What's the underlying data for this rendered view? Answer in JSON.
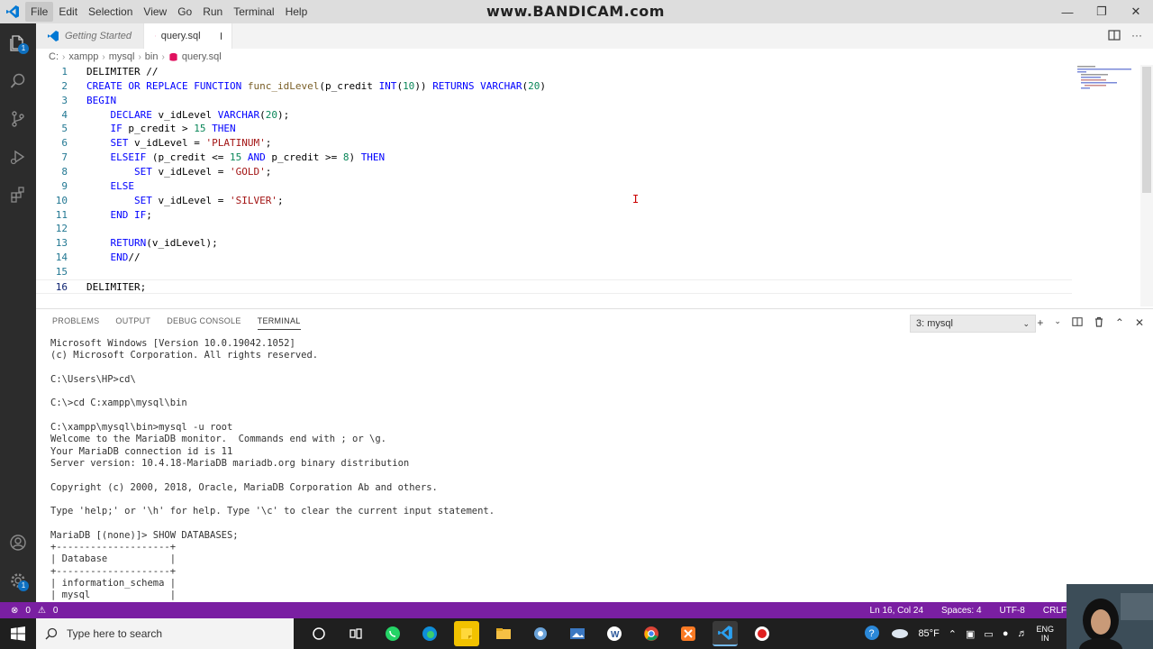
{
  "watermark": "www.BANDICAM.com",
  "menu": [
    "File",
    "Edit",
    "Selection",
    "View",
    "Go",
    "Run",
    "Terminal",
    "Help"
  ],
  "tabs": [
    {
      "label": "Getting Started",
      "active": false
    },
    {
      "label": "query.sql",
      "active": true,
      "modified": true
    }
  ],
  "breadcrumb": [
    "C:",
    "xampp",
    "mysql",
    "bin",
    "query.sql"
  ],
  "editor": {
    "current_line": 16,
    "lines": [
      {
        "n": "1",
        "text": "DELIMITER //"
      },
      {
        "n": "2",
        "text": "CREATE OR REPLACE FUNCTION func_idLevel(p_credit INT(10)) RETURNS VARCHAR(20)"
      },
      {
        "n": "3",
        "text": "BEGIN"
      },
      {
        "n": "4",
        "text": "    DECLARE v_idLevel VARCHAR(20);"
      },
      {
        "n": "5",
        "text": "    IF p_credit > 15 THEN"
      },
      {
        "n": "6",
        "text": "    SET v_idLevel = 'PLATINUM';"
      },
      {
        "n": "7",
        "text": "    ELSEIF (p_credit <= 15 AND p_credit >= 8) THEN"
      },
      {
        "n": "8",
        "text": "        SET v_idLevel = 'GOLD';"
      },
      {
        "n": "9",
        "text": "    ELSE"
      },
      {
        "n": "10",
        "text": "        SET v_idLevel = 'SILVER';"
      },
      {
        "n": "11",
        "text": "    END IF;"
      },
      {
        "n": "12",
        "text": ""
      },
      {
        "n": "13",
        "text": "    RETURN(v_idLevel);"
      },
      {
        "n": "14",
        "text": "    END//"
      },
      {
        "n": "15",
        "text": ""
      },
      {
        "n": "16",
        "text": "DELIMITER;"
      }
    ]
  },
  "panel": {
    "tabs": [
      "PROBLEMS",
      "OUTPUT",
      "DEBUG CONSOLE",
      "TERMINAL"
    ],
    "active_tab": "TERMINAL",
    "terminal_select": "3: mysql",
    "terminal_lines": [
      "Microsoft Windows [Version 10.0.19042.1052]",
      "(c) Microsoft Corporation. All rights reserved.",
      "",
      "C:\\Users\\HP>cd\\",
      "",
      "C:\\>cd C:xampp\\mysql\\bin",
      "",
      "C:\\xampp\\mysql\\bin>mysql -u root",
      "Welcome to the MariaDB monitor.  Commands end with ; or \\g.",
      "Your MariaDB connection id is 11",
      "Server version: 10.4.18-MariaDB mariadb.org binary distribution",
      "",
      "Copyright (c) 2000, 2018, Oracle, MariaDB Corporation Ab and others.",
      "",
      "Type 'help;' or '\\h' for help. Type '\\c' to clear the current input statement.",
      "",
      "MariaDB [(none)]> SHOW DATABASES;",
      "+--------------------+",
      "| Database           |",
      "+--------------------+",
      "| information_schema |",
      "| mysql              |"
    ]
  },
  "status": {
    "errors": "0",
    "warnings": "0",
    "position": "Ln 16, Col 24",
    "spaces": "Spaces: 4",
    "encoding": "UTF-8",
    "eol": "CRLF"
  },
  "taskbar": {
    "search_placeholder": "Type here to search",
    "temperature": "85°F",
    "lang_top": "ENG",
    "lang_bottom": "IN"
  },
  "colors": {
    "statusbar": "#7a1fa2",
    "activitybar": "#2c2c2c",
    "keyword": "#0000ff",
    "string": "#a31515",
    "function": "#795e26",
    "number": "#098658"
  }
}
